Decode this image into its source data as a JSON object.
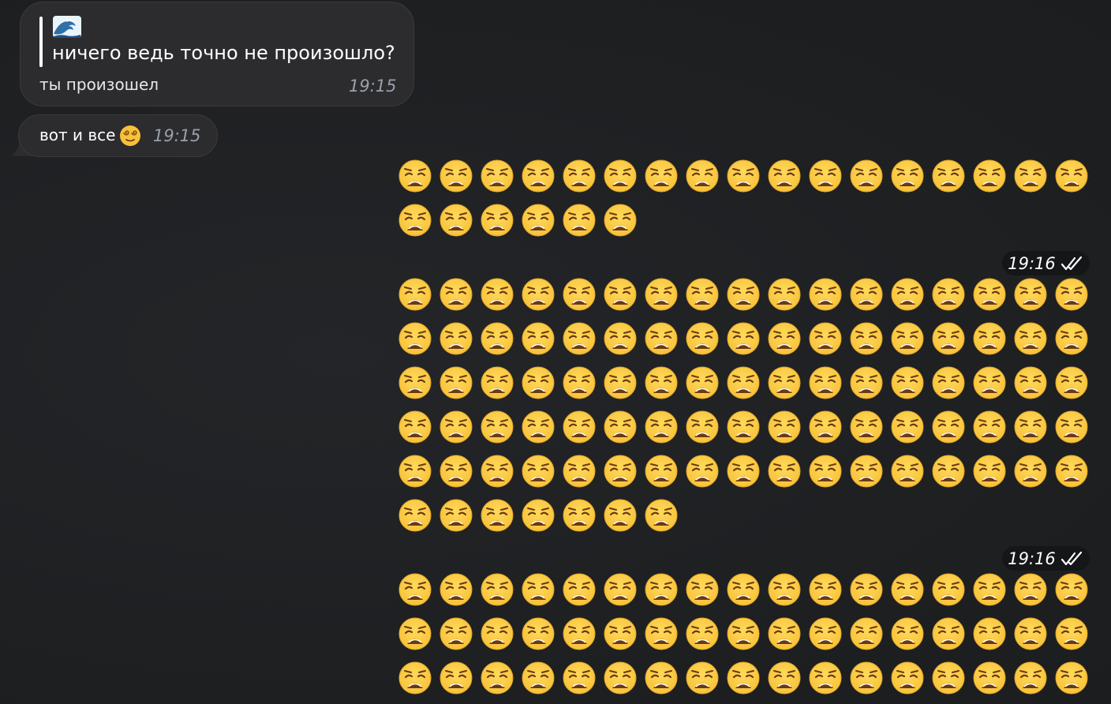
{
  "messages": {
    "reply": {
      "quote_icon": "water-wave-icon",
      "quote_text": "ничего ведь точно не произошло?",
      "text": "ты произошел",
      "time": "19:15"
    },
    "short": {
      "text": "вот и все",
      "emoji": "face-with-spiral-eyes-icon",
      "time": "19:15"
    },
    "outgoing": [
      {
        "emoji": "weary-face-icon",
        "count": 23,
        "time": "19:16",
        "status": "read-double-check-icon"
      },
      {
        "emoji": "weary-face-icon",
        "count": 92,
        "time": "19:16",
        "status": "read-double-check-icon"
      },
      {
        "emoji": "weary-face-icon",
        "count": 51,
        "time": "",
        "status": ""
      }
    ]
  },
  "colors": {
    "background": "#1f2123",
    "incoming_bubble": "#2c2c2e",
    "time_pill": "#141618",
    "time_incoming": "#9aa0ab",
    "emoji_yellow": "#f7c23a"
  }
}
